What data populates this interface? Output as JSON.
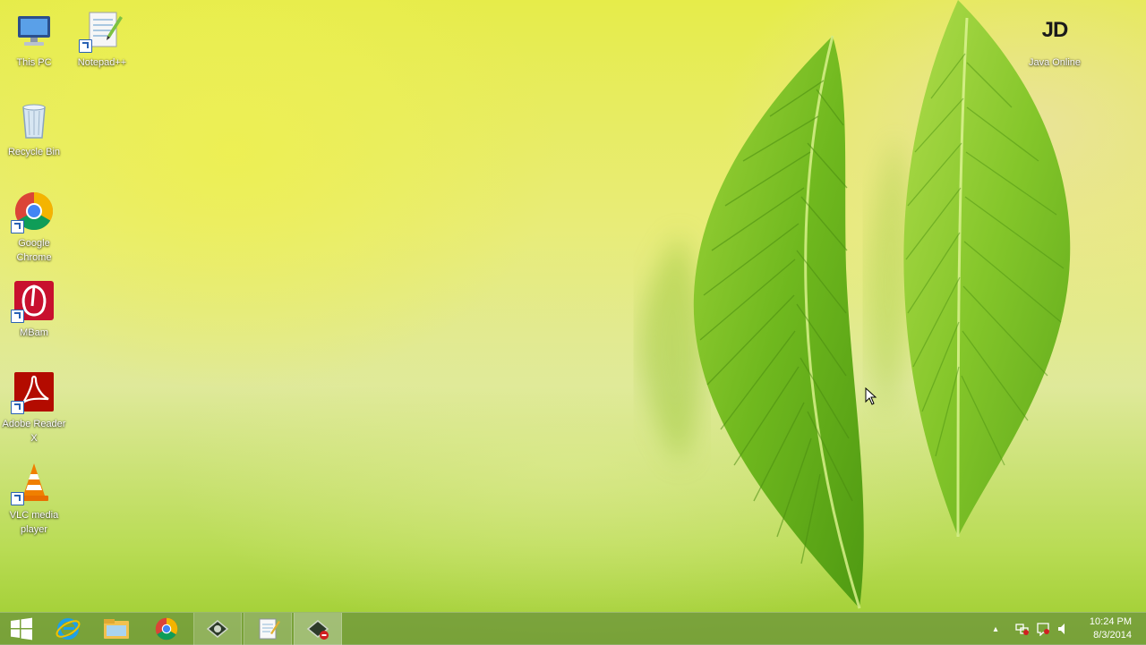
{
  "desktop": {
    "icons": [
      {
        "label": "This PC",
        "icon": "computer-icon"
      },
      {
        "label": "Notepad++",
        "icon": "notepad-plus-plus-icon"
      },
      {
        "label": "Recycle Bin",
        "icon": "recycle-bin-icon"
      },
      {
        "label": "Google Chrome",
        "icon": "chrome-icon"
      },
      {
        "label": "MBam",
        "icon": "malwarebytes-icon"
      },
      {
        "label": "Adobe Reader X",
        "icon": "adobe-reader-icon"
      },
      {
        "label": "VLC media player",
        "icon": "vlc-icon"
      },
      {
        "label": "Java Online",
        "icon": "jdownloader-icon",
        "logo_text": "JD"
      }
    ]
  },
  "taskbar": {
    "start_icon": "windows-start-icon",
    "pinned": [
      {
        "name": "internet-explorer-icon"
      },
      {
        "name": "file-explorer-icon"
      },
      {
        "name": "chrome-icon"
      },
      {
        "name": "media-app-icon"
      },
      {
        "name": "notepad-icon"
      },
      {
        "name": "active-app-icon"
      }
    ],
    "tray": {
      "icons": [
        "show-hidden-icons-chevron",
        "network-icon",
        "action-center-icon",
        "volume-icon"
      ],
      "chevron_glyph": "▴"
    },
    "clock": {
      "time": "10:24 PM",
      "date": "8/3/2014"
    }
  },
  "colors": {
    "taskbar": "#6e963c",
    "leaf_dark": "#5da31a",
    "leaf_light": "#a8d84a"
  }
}
